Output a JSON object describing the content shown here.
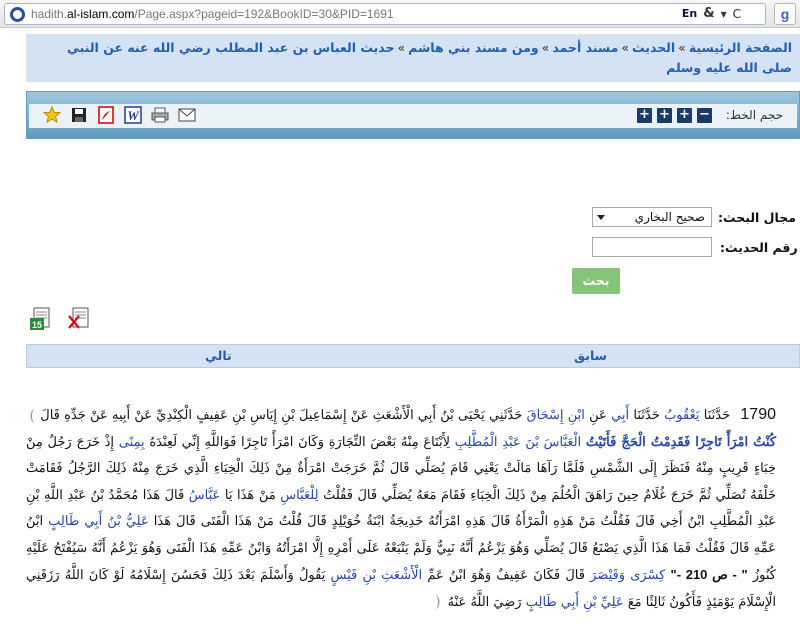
{
  "browser": {
    "url_prefix": "hadith.",
    "url_domain": "al-islam.com",
    "url_path": "/Page.aspx?pageid=192&BookID=30&PID=1691",
    "tool_en": "En",
    "tool_amp": "&",
    "tool_dd": "▾",
    "tool_reload": "C",
    "google": "g"
  },
  "breadcrumb": {
    "home": "الصفحة الرئيسية",
    "hadith": "الحديث",
    "musnad": "مسند أحمد",
    "banihashim": "ومن مسند بني هاشم",
    "current": "حديث العباس بن عبد المطلب رضي الله عنه عن النبي صلى الله عليه وسلم",
    "sep": "»"
  },
  "toolbar": {
    "font_size_label": "حجم الخط:",
    "minus": "−",
    "plus": "+",
    "icons": [
      "mail-icon",
      "print-icon",
      "word-icon",
      "pdf-icon",
      "save-icon",
      "favorite-star-icon"
    ]
  },
  "search": {
    "field_label": "مجال البحث:",
    "field_value": "صحيح البخاري",
    "number_label": "رقم الحديث:",
    "number_value": "",
    "button": "بحث"
  },
  "nav": {
    "prev": "سابق",
    "next": "تالي"
  },
  "hadith": {
    "number": "1790",
    "t1": "حَدَّثَنَا",
    "n1": "يَعْقُوبُ",
    "t2": "حَدَّثَنَا",
    "n2": "أَبِي",
    "t3": "عَنِ",
    "n3": "ابْنِ إِسْحَاقَ",
    "t4": "حَدَّثَنِي يَحْيَى بْنُ أَبِي الْأَشْعَثِ عَنْ إِسْمَاعِيلَ بْنِ إِيَاسِ بْنِ عَفِيفٍ الْكِنْدِيِّ عَنْ أَبِيهِ عَنْ جَدِّهِ قَالَ",
    "b1": "كُنْتُ امْرَأً تَاجِرًا فَقَدِمْتُ الْحَجَّ فَأَتَيْتُ",
    "n4": "الْعَبَّاسَ بْنَ عَبْدِ الْمُطَّلِبِ",
    "t5": "لِأَبْتَاعَ مِنْهُ بَعْضَ التِّجَارَةِ وَكَانَ امْرَأً تَاجِرًا فَوَاللَّهِ إِنِّي لَعِنْدَهُ",
    "n5": "بِمِنًى",
    "t6": "إِذْ خَرَجَ رَجُلٌ مِنْ خِبَاءٍ قَرِيبٍ مِنْهُ فَنَظَرَ إِلَى الشَّمْسِ فَلَمَّا رَآهَا مَالَتْ يَعْنِي قَامَ يُصَلِّي قَالَ ثُمَّ خَرَجَتْ امْرَأَةٌ مِنْ ذَلِكَ الْخِبَاءِ الَّذِي خَرَجَ مِنْهُ ذَلِكَ الرَّجُلُ فَقَامَتْ خَلْفَهُ تُصَلِّي ثُمَّ خَرَجَ غُلَامٌ حِينَ رَاهَقَ الْحُلُمَ مِنْ ذَلِكَ الْخِبَاءِ فَقَامَ مَعَهُ يُصَلِّي قَالَ فَقُلْتُ",
    "n6": "لِلْعَبَّاسِ",
    "t7": "مَنْ هَذَا يَا",
    "n7": "عَبَّاسُ",
    "t8": "قَالَ هَذَا مُحَمَّدُ بْنُ عَبْدِ اللَّهِ بْنِ عَبْدِ الْمُطَّلِبِ ابْنُ أَخِي قَالَ فَقُلْتُ مَنْ هَذِهِ الْمَرْأَةُ قَالَ هَذِهِ امْرَأَتُهُ خَدِيجَةُ ابْنَةُ خُوَيْلِدٍ قَالَ قُلْتُ مَنْ هَذَا الْفَتَى قَالَ هَذَا",
    "n8": "عَلِيُّ بْنُ أَبِي طَالِبٍ",
    "t9": "ابْنُ عَمِّهِ قَالَ فَقُلْتُ فَمَا هَذَا الَّذِي يَصْنَعُ قَالَ يُصَلِّي وَهُوَ يَزْعُمُ أَنَّهُ نَبِيٌّ وَلَمْ يَتْبَعْهُ عَلَى أَمْرِهِ إِلَّا امْرَأَتُهُ وَابْنُ عَمِّهِ هَذَا الْفَتَى وَهُوَ يَزْعُمُ أَنَّهُ سَيُفْتَحُ عَلَيْهِ كُنُوزُ",
    "page": "\" - ص 210 -\"",
    "n9": "كِسْرَى وَقَيْصَرَ",
    "t10": "قَالَ فَكَانَ عَفِيفٌ وَهُوَ ابْنُ عَمِّ",
    "n10": "الْأَشْعَثِ بْنِ قَيْسٍ",
    "t11": "يَقُولُ وَأَسْلَمَ بَعْدَ ذَلِكَ فَحَسُنَ إِسْلَامُهُ لَوْ كَانَ اللَّهُ رَزَقَنِي الْإِسْلَامَ يَوْمَئِذٍ فَأَكُونُ ثَالِثًا مَعَ",
    "n11": "عَلِيِّ بْنِ أَبِي طَالِبٍ",
    "t12": "رَضِيَ اللَّهُ عَنْهُ"
  },
  "colors": {
    "link": "#235eb1",
    "band": "#d5e2f3",
    "toolbar": "#5f9cc1",
    "button": "#86c577"
  }
}
